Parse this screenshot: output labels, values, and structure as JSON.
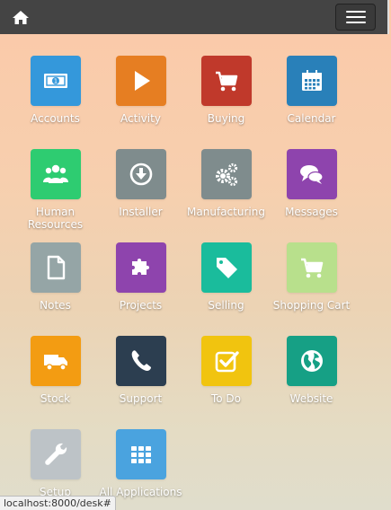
{
  "navbar": {
    "home_icon": "home-icon",
    "menu_icon": "hamburger-icon"
  },
  "apps": [
    {
      "label": "Accounts",
      "color": "#3498db",
      "icon": "money-icon"
    },
    {
      "label": "Activity",
      "color": "#e67e22",
      "icon": "play-icon"
    },
    {
      "label": "Buying",
      "color": "#c0392b",
      "icon": "shopping-cart-icon"
    },
    {
      "label": "Calendar",
      "color": "#2980b9",
      "icon": "calendar-icon"
    },
    {
      "label": "Human Resources",
      "color": "#2ecc71",
      "icon": "group-icon"
    },
    {
      "label": "Installer",
      "color": "#7f8c8d",
      "icon": "download-icon"
    },
    {
      "label": "Manufacturing",
      "color": "#7f8c8d",
      "icon": "cogs-icon"
    },
    {
      "label": "Messages",
      "color": "#8e44ad",
      "icon": "comments-icon"
    },
    {
      "label": "Notes",
      "color": "#95a5a6",
      "icon": "file-icon"
    },
    {
      "label": "Projects",
      "color": "#8e44ad",
      "icon": "puzzle-icon"
    },
    {
      "label": "Selling",
      "color": "#1abc9c",
      "icon": "tag-icon"
    },
    {
      "label": "Shopping Cart",
      "color": "#b8e08c",
      "icon": "shopping-cart-icon"
    },
    {
      "label": "Stock",
      "color": "#f39c12",
      "icon": "truck-icon"
    },
    {
      "label": "Support",
      "color": "#2c3e50",
      "icon": "phone-icon"
    },
    {
      "label": "To Do",
      "color": "#f1c40f",
      "icon": "check-icon"
    },
    {
      "label": "Website",
      "color": "#16a085",
      "icon": "globe-icon"
    },
    {
      "label": "Setup",
      "color": "#bdc3c7",
      "icon": "wrench-icon"
    },
    {
      "label": "All Applications",
      "color": "#4aa3df",
      "icon": "th-icon"
    }
  ],
  "status_bar": {
    "url": "localhost:8000/desk#"
  }
}
